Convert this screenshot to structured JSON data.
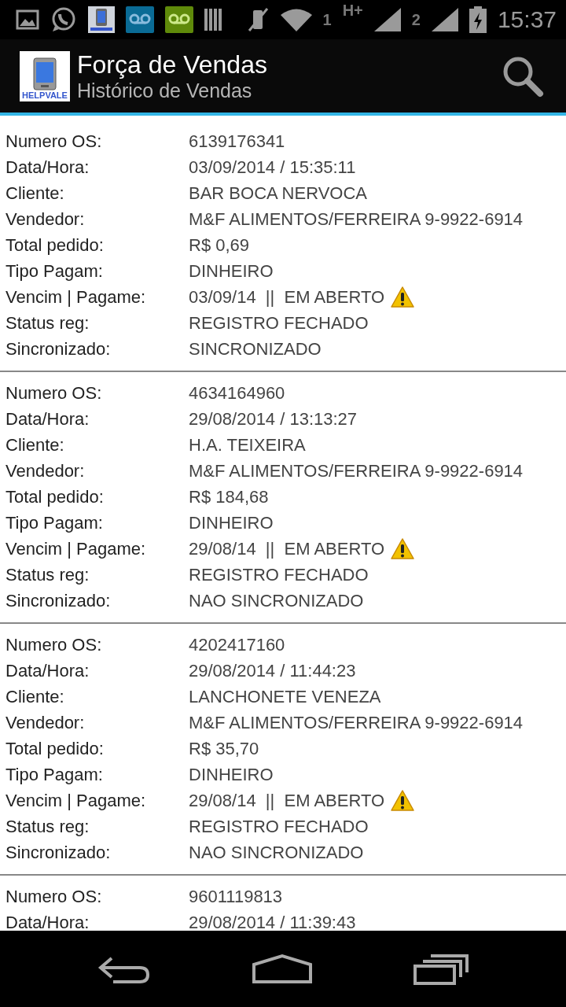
{
  "status_bar": {
    "sim1": "1",
    "network": "H+",
    "sim2": "2",
    "time": "15:37"
  },
  "app_bar": {
    "logo_text": "HELPVALE",
    "title": "Força de Vendas",
    "subtitle": "Histórico de Vendas"
  },
  "records": [
    {
      "fields": [
        {
          "label": "Numero OS:",
          "value": "6139176341",
          "alert": false
        },
        {
          "label": "Data/Hora:",
          "value": "03/09/2014 / 15:35:11",
          "alert": false
        },
        {
          "label": "Cliente:",
          "value": "BAR BOCA NERVOCA",
          "alert": false
        },
        {
          "label": "Vendedor:",
          "value": "M&F ALIMENTOS/FERREIRA 9-9922-6914",
          "alert": false
        },
        {
          "label": "Total pedido:",
          "value": "R$ 0,69",
          "alert": false
        },
        {
          "label": "Tipo Pagam:",
          "value": "DINHEIRO",
          "alert": false
        },
        {
          "label": "Vencim | Pagame:",
          "value": "03/09/14  ||  EM ABERTO",
          "alert": true
        },
        {
          "label": "Status reg:",
          "value": "REGISTRO FECHADO",
          "alert": false
        },
        {
          "label": "Sincronizado:",
          "value": "SINCRONIZADO",
          "alert": false
        }
      ]
    },
    {
      "fields": [
        {
          "label": "Numero OS:",
          "value": "4634164960",
          "alert": false
        },
        {
          "label": "Data/Hora:",
          "value": "29/08/2014 / 13:13:27",
          "alert": false
        },
        {
          "label": "Cliente:",
          "value": "H.A. TEIXEIRA",
          "alert": false
        },
        {
          "label": "Vendedor:",
          "value": "M&F ALIMENTOS/FERREIRA 9-9922-6914",
          "alert": false
        },
        {
          "label": "Total pedido:",
          "value": "R$ 184,68",
          "alert": false
        },
        {
          "label": "Tipo Pagam:",
          "value": "DINHEIRO",
          "alert": false
        },
        {
          "label": "Vencim | Pagame:",
          "value": "29/08/14  ||  EM ABERTO",
          "alert": true
        },
        {
          "label": "Status reg:",
          "value": "REGISTRO FECHADO",
          "alert": false
        },
        {
          "label": "Sincronizado:",
          "value": "NAO SINCRONIZADO",
          "alert": false
        }
      ]
    },
    {
      "fields": [
        {
          "label": "Numero OS:",
          "value": "4202417160",
          "alert": false
        },
        {
          "label": "Data/Hora:",
          "value": "29/08/2014 / 11:44:23",
          "alert": false
        },
        {
          "label": "Cliente:",
          "value": "LANCHONETE VENEZA",
          "alert": false
        },
        {
          "label": "Vendedor:",
          "value": "M&F ALIMENTOS/FERREIRA 9-9922-6914",
          "alert": false
        },
        {
          "label": "Total pedido:",
          "value": "R$ 35,70",
          "alert": false
        },
        {
          "label": "Tipo Pagam:",
          "value": "DINHEIRO",
          "alert": false
        },
        {
          "label": "Vencim | Pagame:",
          "value": "29/08/14  ||  EM ABERTO",
          "alert": true
        },
        {
          "label": "Status reg:",
          "value": "REGISTRO FECHADO",
          "alert": false
        },
        {
          "label": "Sincronizado:",
          "value": "NAO SINCRONIZADO",
          "alert": false
        }
      ]
    },
    {
      "fields": [
        {
          "label": "Numero OS:",
          "value": "9601119813",
          "alert": false
        },
        {
          "label": "Data/Hora:",
          "value": "29/08/2014 / 11:39:43",
          "alert": false
        }
      ]
    }
  ]
}
